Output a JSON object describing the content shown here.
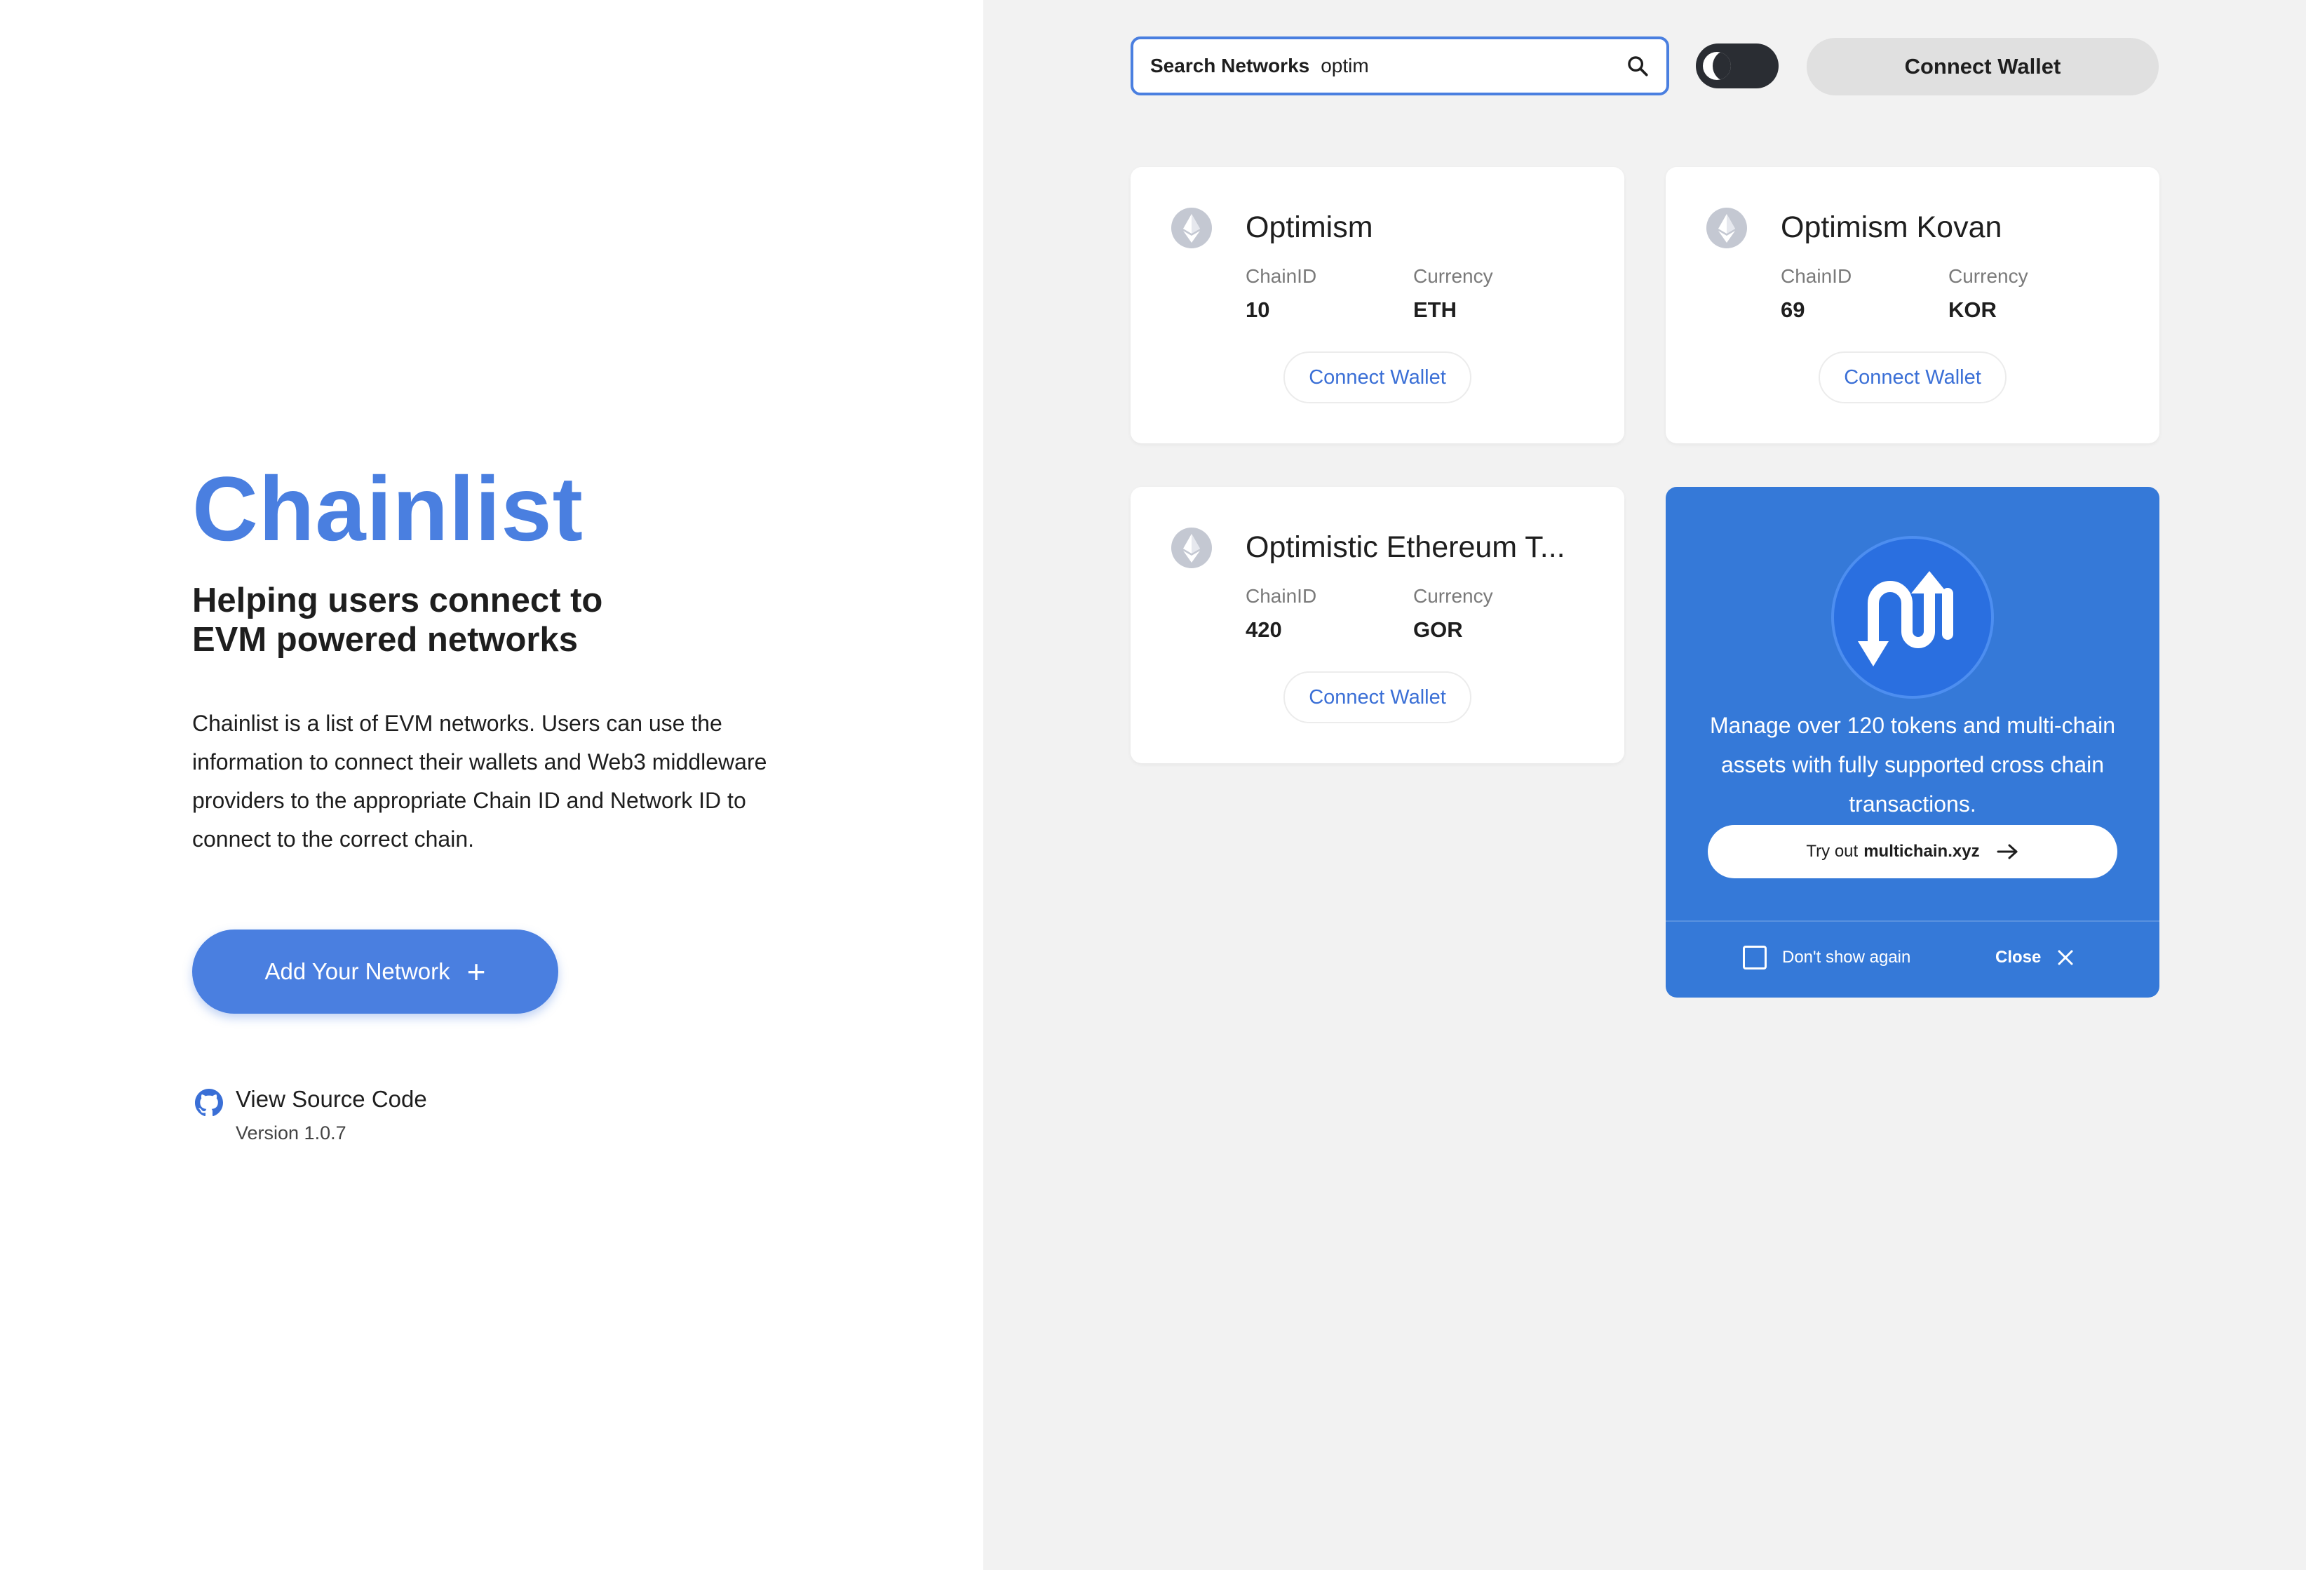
{
  "brand": {
    "title": "Chainlist",
    "tagline": "Helping users connect to EVM powered networks",
    "description": "Chainlist is a list of EVM networks. Users can use the information to connect their wallets and Web3 middleware providers to the appropriate Chain ID and Network ID to connect to the correct chain.",
    "add_network_label": "Add Your Network",
    "source_link": "View Source Code",
    "version": "Version 1.0.7",
    "accent_color": "#4a7fe0"
  },
  "header": {
    "search_label": "Search Networks",
    "search_value": "optim",
    "connect_wallet_label": "Connect Wallet",
    "theme": "dark"
  },
  "field_labels": {
    "chain_id": "ChainID",
    "currency": "Currency"
  },
  "networks": [
    {
      "name": "Optimism",
      "chain_id": "10",
      "currency": "ETH",
      "connect_label": "Connect Wallet",
      "icon": "ethereum-icon"
    },
    {
      "name": "Optimism Kovan",
      "chain_id": "69",
      "currency": "KOR",
      "connect_label": "Connect Wallet",
      "icon": "ethereum-icon"
    },
    {
      "name": "Optimistic Ethereum T...",
      "chain_id": "420",
      "currency": "GOR",
      "connect_label": "Connect Wallet",
      "icon": "ethereum-icon"
    }
  ],
  "promo": {
    "text": "Manage over 120 tokens and multi-chain assets with fully supported cross chain transactions.",
    "cta_prefix": "Try out",
    "cta_site": "multichain.xyz",
    "dont_show_label": "Don't show again",
    "close_label": "Close",
    "background_color": "#3579d8"
  }
}
